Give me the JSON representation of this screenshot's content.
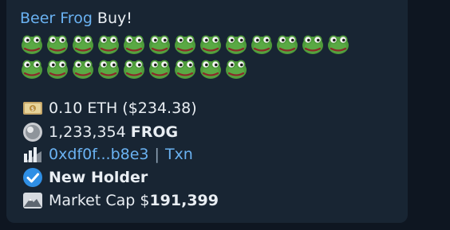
{
  "message": {
    "title_link": "Beer Frog",
    "title_rest": " Buy!",
    "frog_rows": [
      13,
      9
    ],
    "eth_line": "0.10 ETH ($234.38)",
    "token_amount": "1,233,354",
    "token_symbol": "FROG",
    "wallet_link": "0xdf0f...b8e3",
    "separator": "|",
    "txn_link": "Txn",
    "holder_label": "New Holder",
    "market_cap_label": "Market Cap $",
    "market_cap_value": "191,399",
    "icons": [
      "frog-emoji",
      "money-emoji",
      "coin-emoji",
      "chart-logo-icon",
      "check-icon",
      "mountain-icon"
    ],
    "colors": {
      "link": "#6ab2f2",
      "bubble": "#182533",
      "background": "#0e1621",
      "frog": "#4f9c3b",
      "check": "#2f8fe5"
    }
  }
}
